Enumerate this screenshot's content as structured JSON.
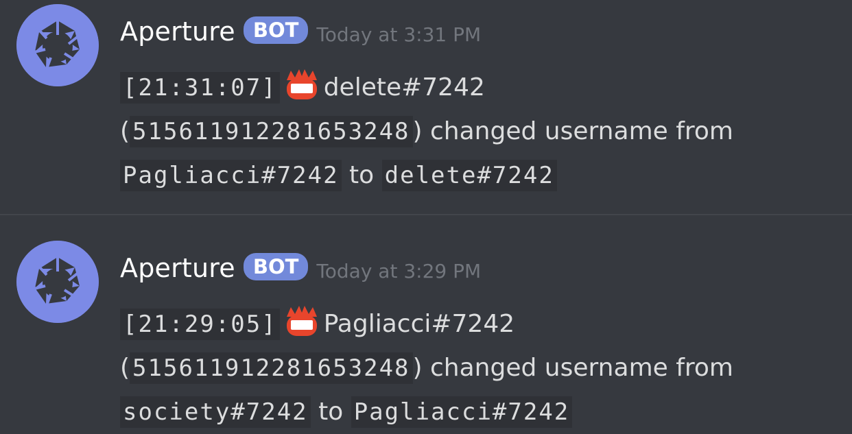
{
  "messages": [
    {
      "author": "Aperture",
      "tag": "BOT",
      "timestamp": "Today at 3:31 PM",
      "time_code": "[21:31:07]",
      "emoji_icon": "name-badge-icon",
      "new_name": "delete#7242",
      "user_id_open": "(",
      "user_id": "515611912281653248",
      "user_id_close": ")",
      "action_text": "changed username from",
      "old_username": "Pagliacci#7242",
      "to_text": "to",
      "new_username": "delete#7242"
    },
    {
      "author": "Aperture",
      "tag": "BOT",
      "timestamp": "Today at 3:29 PM",
      "time_code": "[21:29:05]",
      "emoji_icon": "name-badge-icon",
      "new_name": "Pagliacci#7242",
      "user_id_open": "(",
      "user_id": "515611912281653248",
      "user_id_close": ")",
      "action_text": "changed username from",
      "old_username": "society#7242",
      "to_text": "to",
      "new_username": "Pagliacci#7242"
    }
  ],
  "colors": {
    "background": "#36393f",
    "bot_tag": "#7289da",
    "avatar": "#7c8ae6",
    "code_background": "#2f3136",
    "timestamp": "#72767d"
  }
}
